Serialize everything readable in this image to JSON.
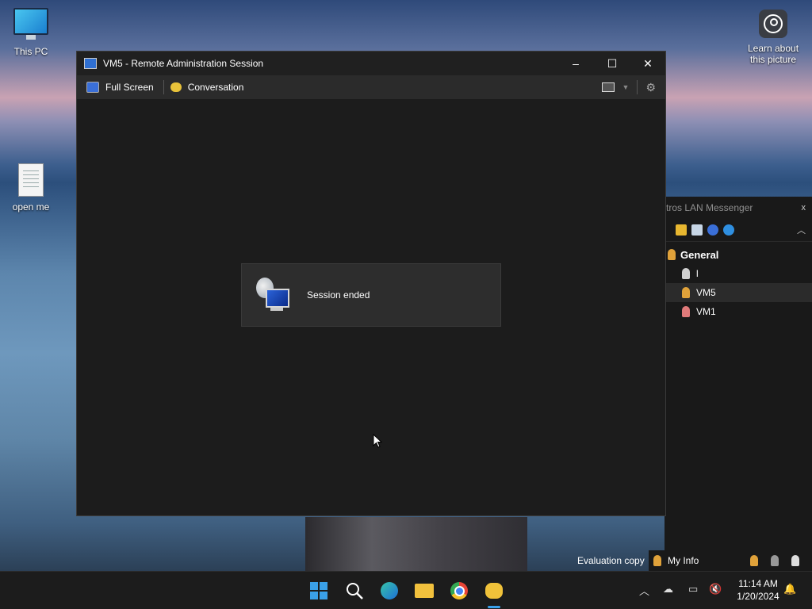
{
  "desktop": {
    "icons": [
      {
        "label": "This PC"
      },
      {
        "label": "open me"
      }
    ],
    "learn_label": "Learn about this picture"
  },
  "window": {
    "title": "VM5 - Remote Administration Session",
    "controls": {
      "minimize": "–",
      "maximize": "☐",
      "close": "✕"
    },
    "toolbar": {
      "fullscreen": "Full Screen",
      "conversation": "Conversation"
    },
    "toast": {
      "message": "Session ended"
    }
  },
  "messenger": {
    "title": "tros LAN Messenger",
    "close": "x",
    "group": "General",
    "users": [
      {
        "name": "l",
        "status_color": "#d0d0d0",
        "selected": false
      },
      {
        "name": "VM5",
        "status_color": "#e0a23a",
        "selected": true
      },
      {
        "name": "VM1",
        "status_color": "#e07a7a",
        "selected": false
      }
    ],
    "footer_label": "My Info"
  },
  "evaluation_text": "Evaluation copy",
  "taskbar": {
    "apps": [
      "start-icon",
      "search-icon",
      "edge-icon",
      "file-explorer-icon",
      "chrome-icon",
      "messenger-icon"
    ],
    "time": "11:14 AM",
    "date": "1/20/2024"
  },
  "colors": {
    "accent": "#3aa0e8",
    "window_bg": "#1c1c1c",
    "toolbar_bg": "#2b2b2b"
  }
}
